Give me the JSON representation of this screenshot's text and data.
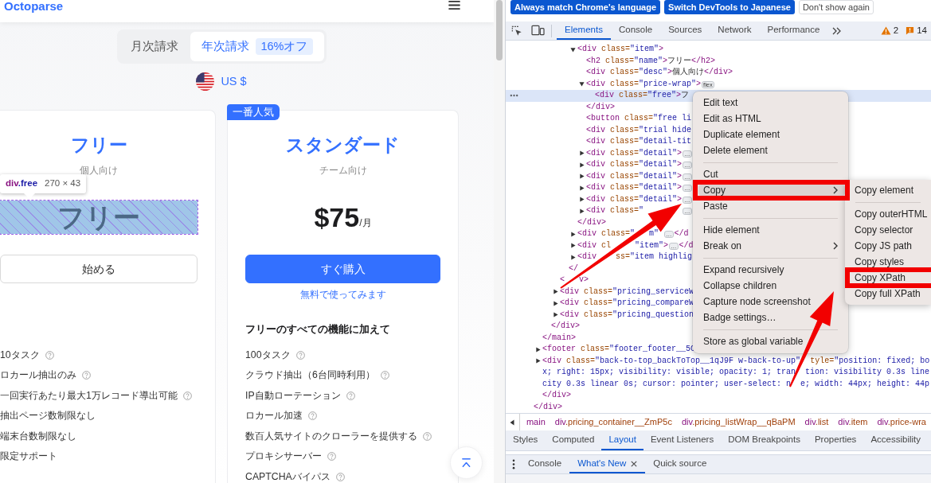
{
  "site": {
    "logo": "Octoparse",
    "billing_options": [
      {
        "label": "月次請求",
        "selected": false
      },
      {
        "label": "年次請求",
        "selected": true,
        "discount": "16%オフ"
      }
    ],
    "currency": "US $",
    "plans": [
      {
        "name": "フリー",
        "audience": "個人向け",
        "price": {
          "amount": "フリー",
          "inspected": true
        },
        "action": {
          "label": "始める",
          "kind": "outline"
        },
        "features": [
          {
            "text": "10タスク",
            "help": true
          },
          {
            "text": "ロカール抽出のみ",
            "help": true
          },
          {
            "text": "一回実行あたり最大1万レコード導出可能",
            "help": true
          },
          {
            "text": "抽出ページ数制限なし",
            "help": false
          },
          {
            "text": "端末台数制限なし",
            "help": false
          },
          {
            "text": "限定サポート",
            "help": false
          }
        ]
      },
      {
        "name": "スタンダード",
        "audience": "チーム向け",
        "ribbon": "一番人気",
        "price": {
          "amount": "$75",
          "period": "/月",
          "inspected": false
        },
        "action": {
          "label": "すぐ購入",
          "kind": "primary"
        },
        "trial_link": "無料で使ってみます",
        "features_heading": "フリーのすべての機能に加えて",
        "features": [
          {
            "text": "100タスク",
            "help": true
          },
          {
            "text": "クラウド抽出（6台同時利用）",
            "help": true
          },
          {
            "text": "IP自動ローテーション",
            "help": true
          },
          {
            "text": "ロカール加速",
            "help": true
          },
          {
            "text": "数百人気サイトのクローラーを提供する",
            "help": true
          },
          {
            "text": "プロキシサーバー",
            "help": true
          },
          {
            "text": "CAPTCHAバイパス",
            "help": true
          }
        ]
      }
    ],
    "inspect_tooltip": {
      "selector": "div.free",
      "size": "270 × 43"
    }
  },
  "devtools": {
    "language_bar": [
      {
        "label": "Always match Chrome's language",
        "kind": "primary"
      },
      {
        "label": "Switch DevTools to Japanese",
        "kind": "primary"
      },
      {
        "label": "Don't show again",
        "kind": "outline"
      }
    ],
    "panel_tabs": [
      {
        "label": "Elements",
        "selected": true
      },
      {
        "label": "Console",
        "selected": false
      },
      {
        "label": "Sources",
        "selected": false
      },
      {
        "label": "Network",
        "selected": false
      },
      {
        "label": "Performance",
        "selected": false
      }
    ],
    "warning_count": "2",
    "issue_count": "14",
    "elements_tree": [
      {
        "close": "</div>",
        "selected": false,
        "children": [
          {
            "close": "</main>",
            "selected": false,
            "children": [
              {
                "close": "</div>",
                "selected": false,
                "children": [
                  {
                    "close": "<   v>",
                    "selected": false,
                    "children": [
                      {
                        "close": "</",
                        "selected": false,
                        "children": [
                          {
                            "open": "<div class=\"item\">",
                            "expanded": true,
                            "selected": false,
                            "close": "</div>",
                            "children": [
                              {
                                "open": "<h2 class=\"name\">フリー</h2>",
                                "selected": false
                              },
                              {
                                "open": "<div class=\"desc\">個人向け</div>",
                                "selected": false
                              },
                              {
                                "open": "<div class=\"price-wrap\">",
                                "expanded": true,
                                "badge": "flex",
                                "selected": false,
                                "close": "</div>",
                                "children": [
                                  {
                                    "open": "<div class=\"free\">フ",
                                    "selected": true
                                  }
                                ]
                              },
                              {
                                "open": "<button class=\"free li",
                                "selected": false
                              },
                              {
                                "open": "<div class=\"trial hide",
                                "selected": false
                              },
                              {
                                "open": "<div class=\"detail-tit",
                                "selected": false
                              },
                              {
                                "open": "<div class=\"detail\">",
                                "expanded": false,
                                "badge": "…",
                                "selected": false
                              },
                              {
                                "open": "<div class=\"detail\">",
                                "expanded": false,
                                "badge": "…",
                                "selected": false
                              },
                              {
                                "open": "<div class=\"detail\">",
                                "expanded": false,
                                "badge": "…",
                                "selected": false
                              },
                              {
                                "open": "<div class=\"detail\">",
                                "expanded": false,
                                "badge": "…",
                                "selected": false
                              },
                              {
                                "open": "<div class=\"detail\">",
                                "expanded": false,
                                "badge": "…",
                                "selected": false
                              },
                              {
                                "open": "<div class=\"        ",
                                "expanded": false,
                                "badge": "…",
                                "selected": false
                              }
                            ]
                          },
                          {
                            "open": "<div class=\"   m\" ",
                            "expanded": false,
                            "badge": "…",
                            "after": "</d",
                            "selected": false
                          },
                          {
                            "open": "<div cl     \"item\">",
                            "expanded": false,
                            "badge": "…",
                            "after": "</d",
                            "selected": false
                          },
                          {
                            "open": "<div    ss=\"item highlig",
                            "expanded": false,
                            "selected": false
                          }
                        ]
                      }
                    ]
                  },
                  {
                    "open": "<div class=\"pricing_serviceW",
                    "expanded": false,
                    "selected": false
                  },
                  {
                    "open": "<div class=\"pricing_compareW",
                    "expanded": false,
                    "selected": false
                  },
                  {
                    "open": "<div class=\"pricing_question",
                    "expanded": false,
                    "selected": false
                  }
                ]
              }
            ]
          },
          {
            "open": "<footer class=\"footer_footer__5C",
            "expanded": false,
            "selected": false
          },
          {
            "open": "<div class=\"back-to-top_backToTop__1qJ9F w-back-to-up\"  tyle=\"position: fixed; bo",
            "more_lines": [
              "x; right: 15px; visibility: visible; opacity: 1; tran  tion: visibility 0.3s line",
              "city 0.3s linear 0s; cursor: pointer; user-select: n  e; width: 44px; height: 44p"
            ],
            "expanded": false,
            "close": "</div>",
            "selected": false
          }
        ]
      }
    ],
    "context_menu": {
      "items": [
        {
          "kind": "item",
          "label": "Edit text",
          "highlighted": false,
          "submenu": false,
          "callout": false
        },
        {
          "kind": "item",
          "label": "Edit as HTML",
          "highlighted": false,
          "submenu": false,
          "callout": false
        },
        {
          "kind": "item",
          "label": "Duplicate element",
          "highlighted": false,
          "submenu": false,
          "callout": false
        },
        {
          "kind": "item",
          "label": "Delete element",
          "highlighted": false,
          "submenu": false,
          "callout": false
        },
        {
          "kind": "separator"
        },
        {
          "kind": "item",
          "label": "Cut",
          "highlighted": false,
          "submenu": false,
          "callout": false
        },
        {
          "kind": "item",
          "label": "Copy",
          "highlighted": true,
          "submenu": true,
          "callout": true
        },
        {
          "kind": "item",
          "label": "Paste",
          "highlighted": false,
          "submenu": false,
          "callout": false
        },
        {
          "kind": "separator"
        },
        {
          "kind": "item",
          "label": "Hide element",
          "highlighted": false,
          "submenu": false,
          "callout": false
        },
        {
          "kind": "item",
          "label": "Break on",
          "highlighted": false,
          "submenu": true,
          "callout": false
        },
        {
          "kind": "separator"
        },
        {
          "kind": "item",
          "label": "Expand recursively",
          "highlighted": false,
          "submenu": false,
          "callout": false
        },
        {
          "kind": "item",
          "label": "Collapse children",
          "highlighted": false,
          "submenu": false,
          "callout": false
        },
        {
          "kind": "item",
          "label": "Capture node screenshot",
          "highlighted": false,
          "submenu": false,
          "callout": false
        },
        {
          "kind": "item",
          "label": "Badge settings…",
          "highlighted": false,
          "submenu": false,
          "callout": false
        },
        {
          "kind": "separator"
        },
        {
          "kind": "item",
          "label": "Store as global variable",
          "highlighted": false,
          "submenu": false,
          "callout": false
        }
      ]
    },
    "copy_submenu": {
      "items": [
        {
          "kind": "item",
          "label": "Copy element",
          "highlighted": false,
          "submenu": false,
          "callout": false
        },
        {
          "kind": "separator"
        },
        {
          "kind": "item",
          "label": "Copy outerHTML",
          "highlighted": false,
          "submenu": false,
          "callout": false
        },
        {
          "kind": "item",
          "label": "Copy selector",
          "highlighted": false,
          "submenu": false,
          "callout": false
        },
        {
          "kind": "item",
          "label": "Copy JS path",
          "highlighted": false,
          "submenu": false,
          "callout": false
        },
        {
          "kind": "item",
          "label": "Copy styles",
          "highlighted": false,
          "submenu": false,
          "callout": false
        },
        {
          "kind": "item",
          "label": "Copy XPath",
          "highlighted": false,
          "submenu": false,
          "callout": true
        },
        {
          "kind": "item",
          "label": "Copy full XPath",
          "highlighted": false,
          "submenu": false,
          "callout": false
        }
      ]
    },
    "breadcrumbs": [
      "main",
      "div.pricing_container__ZmP5c",
      "div.pricing_listWrap__qBaPM",
      "div.list",
      "div.item",
      "div.price-wra"
    ],
    "sidebar_tabs": [
      {
        "label": "Styles",
        "selected": false
      },
      {
        "label": "Computed",
        "selected": false
      },
      {
        "label": "Layout",
        "selected": true
      },
      {
        "label": "Event Listeners",
        "selected": false
      },
      {
        "label": "DOM Breakpoints",
        "selected": false
      },
      {
        "label": "Properties",
        "selected": false
      },
      {
        "label": "Accessibility",
        "selected": false
      }
    ],
    "drawer_tabs": [
      {
        "label": "Console",
        "selected": false,
        "closable": false
      },
      {
        "label": "What's New",
        "selected": true,
        "closable": true
      },
      {
        "label": "Quick source",
        "selected": false,
        "closable": false
      }
    ]
  }
}
